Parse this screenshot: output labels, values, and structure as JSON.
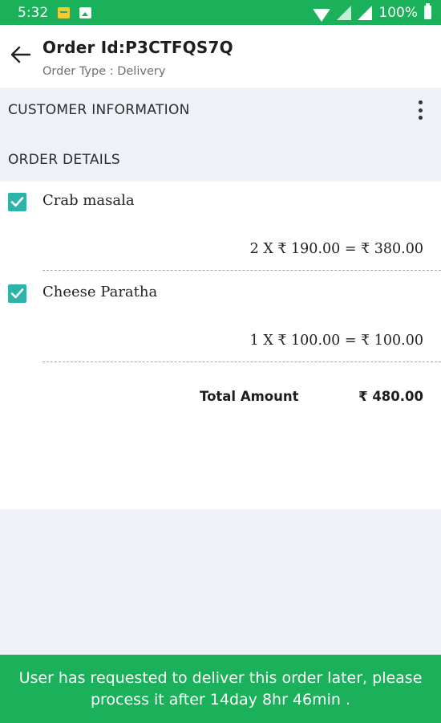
{
  "status_bar": {
    "time": "5:32",
    "battery": "100%",
    "icons": [
      "file-notification-icon",
      "image-notification-icon",
      "wifi-icon",
      "signal-icon",
      "signal-icon",
      "battery-icon"
    ]
  },
  "header": {
    "title": "Order Id:P3CTFQS7Q",
    "subtitle": "Order Type : Delivery"
  },
  "sections": {
    "customer_info": "CUSTOMER INFORMATION",
    "order_details": "ORDER DETAILS"
  },
  "order": {
    "items": [
      {
        "name": "Crab masala",
        "price_line": "2 X ₹ 190.00 = ₹ 380.00",
        "checked": true
      },
      {
        "name": "Cheese Paratha",
        "price_line": "1 X ₹ 100.00 = ₹ 100.00",
        "checked": true
      }
    ],
    "total_label": "Total Amount",
    "total_value": "₹ 480.00"
  },
  "banner": {
    "message": "User has requested to deliver this order later, please process it after 14day 8hr 46min ."
  },
  "colors": {
    "primary_green": "#1bb05a",
    "checkbox_teal": "#2eb3a8",
    "background": "#eef1f8"
  }
}
